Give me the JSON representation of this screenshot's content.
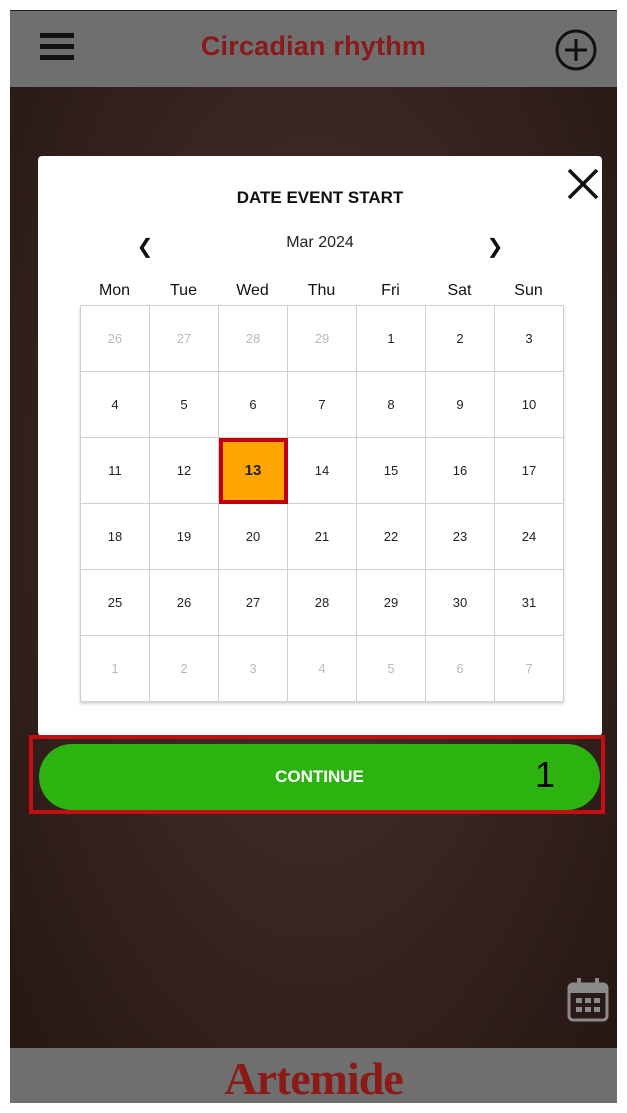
{
  "app": {
    "title": "Circadian rhythm",
    "brand": "Artemide"
  },
  "icons": {
    "menu": "hamburger-menu-icon",
    "add": "plus-circle-icon",
    "close": "close-x-icon",
    "prev": "chevron-left-icon",
    "next": "chevron-right-icon",
    "calendar": "calendar-icon"
  },
  "modal": {
    "title": "DATE EVENT START",
    "month": "Mar 2024",
    "prev_glyph": "❮",
    "next_glyph": "❯",
    "weekdays": [
      "Mon",
      "Tue",
      "Wed",
      "Thu",
      "Fri",
      "Sat",
      "Sun"
    ],
    "days": [
      {
        "label": "26",
        "muted": true
      },
      {
        "label": "27",
        "muted": true
      },
      {
        "label": "28",
        "muted": true
      },
      {
        "label": "29",
        "muted": true
      },
      {
        "label": "1"
      },
      {
        "label": "2"
      },
      {
        "label": "3"
      },
      {
        "label": "4"
      },
      {
        "label": "5"
      },
      {
        "label": "6"
      },
      {
        "label": "7"
      },
      {
        "label": "8"
      },
      {
        "label": "9"
      },
      {
        "label": "10"
      },
      {
        "label": "11"
      },
      {
        "label": "12"
      },
      {
        "label": "13",
        "selected": true
      },
      {
        "label": "14"
      },
      {
        "label": "15"
      },
      {
        "label": "16"
      },
      {
        "label": "17"
      },
      {
        "label": "18"
      },
      {
        "label": "19"
      },
      {
        "label": "20"
      },
      {
        "label": "21"
      },
      {
        "label": "22"
      },
      {
        "label": "23"
      },
      {
        "label": "24"
      },
      {
        "label": "25"
      },
      {
        "label": "26"
      },
      {
        "label": "27"
      },
      {
        "label": "28"
      },
      {
        "label": "29"
      },
      {
        "label": "30"
      },
      {
        "label": "31"
      },
      {
        "label": "1",
        "muted": true
      },
      {
        "label": "2",
        "muted": true
      },
      {
        "label": "3",
        "muted": true
      },
      {
        "label": "4",
        "muted": true
      },
      {
        "label": "5",
        "muted": true
      },
      {
        "label": "6",
        "muted": true
      },
      {
        "label": "7",
        "muted": true
      }
    ]
  },
  "action": {
    "continue_label": "CONTINUE",
    "step_number": "1"
  },
  "colors": {
    "title_red": "#8a1a1a",
    "selected_day": "#ffa500",
    "highlight_red": "#c40f12",
    "button_green": "#2db30f",
    "bar_gray": "#6f6f6f"
  }
}
